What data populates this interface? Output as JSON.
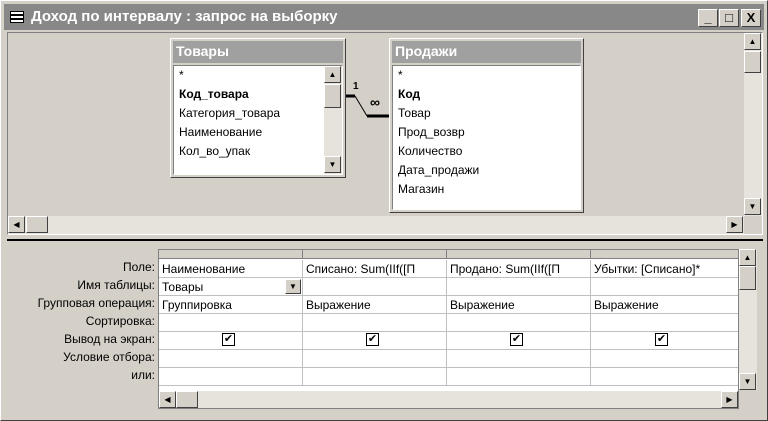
{
  "window": {
    "title": "Доход по интервалу : запрос на выборку",
    "minimize": "_",
    "restore": "□",
    "close": "X"
  },
  "tables": [
    {
      "name": "Товары",
      "fields": [
        {
          "label": "*",
          "bold": false
        },
        {
          "label": "Код_товара",
          "bold": true
        },
        {
          "label": "Категория_товара",
          "bold": false
        },
        {
          "label": "Наименование",
          "bold": false
        },
        {
          "label": "Кол_во_упак",
          "bold": false
        }
      ]
    },
    {
      "name": "Продажи",
      "fields": [
        {
          "label": "*",
          "bold": false
        },
        {
          "label": "Код",
          "bold": true
        },
        {
          "label": "Товар",
          "bold": false
        },
        {
          "label": "Прод_возвр",
          "bold": false
        },
        {
          "label": "Количество",
          "bold": false
        },
        {
          "label": "Дата_продажи",
          "bold": false
        },
        {
          "label": "Магазин",
          "bold": false
        }
      ]
    }
  ],
  "relation": {
    "one_label": "1",
    "many_label": "∞"
  },
  "grid": {
    "row_labels": [
      "Поле:",
      "Имя таблицы:",
      "Групповая операция:",
      "Сортировка:",
      "Вывод на экран:",
      "Условие отбора:",
      "или:"
    ],
    "columns": [
      {
        "field": "Наименование",
        "table": "Товары",
        "group": "Группировка",
        "sort": "",
        "show": true,
        "criteria": "",
        "or": ""
      },
      {
        "field": "Списано: Sum(IIf([П",
        "table": "",
        "group": "Выражение",
        "sort": "",
        "show": true,
        "criteria": "",
        "or": ""
      },
      {
        "field": "Продано: Sum(IIf([П",
        "table": "",
        "group": "Выражение",
        "sort": "",
        "show": true,
        "criteria": "",
        "or": ""
      },
      {
        "field": "Убытки: [Списано]*",
        "table": "",
        "group": "Выражение",
        "sort": "",
        "show": true,
        "criteria": "",
        "or": ""
      }
    ],
    "check_glyph": "✔"
  },
  "icons": {
    "up": "▲",
    "down": "▼",
    "left": "◀",
    "right": "▶",
    "dropdown": "▼"
  }
}
